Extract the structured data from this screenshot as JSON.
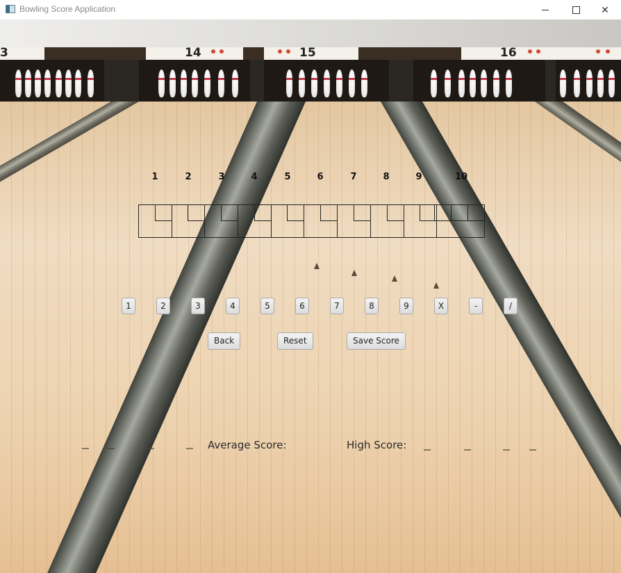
{
  "window": {
    "title": "Bowling Score Application"
  },
  "scene": {
    "lane_numbers": [
      "3",
      "14",
      "15",
      "16"
    ]
  },
  "scorecard": {
    "frame_labels": [
      "1",
      "2",
      "3",
      "4",
      "5",
      "6",
      "7",
      "8",
      "9",
      "10"
    ],
    "frames": [
      {
        "roll1": "",
        "roll2": "",
        "total": ""
      },
      {
        "roll1": "",
        "roll2": "",
        "total": ""
      },
      {
        "roll1": "",
        "roll2": "",
        "total": ""
      },
      {
        "roll1": "",
        "roll2": "",
        "total": ""
      },
      {
        "roll1": "",
        "roll2": "",
        "total": ""
      },
      {
        "roll1": "",
        "roll2": "",
        "total": ""
      },
      {
        "roll1": "",
        "roll2": "",
        "total": ""
      },
      {
        "roll1": "",
        "roll2": "",
        "total": ""
      },
      {
        "roll1": "",
        "roll2": "",
        "total": ""
      },
      {
        "roll1": "",
        "roll2": "",
        "total": ""
      }
    ]
  },
  "keypad": [
    "1",
    "2",
    "3",
    "4",
    "5",
    "6",
    "7",
    "8",
    "9",
    "X",
    "-",
    "/"
  ],
  "actions": {
    "back": "Back",
    "reset": "Reset",
    "save": "Save Score"
  },
  "stats": {
    "average_label": "Average Score:",
    "average_value": "",
    "high_label": "High Score:",
    "high_value": ""
  }
}
